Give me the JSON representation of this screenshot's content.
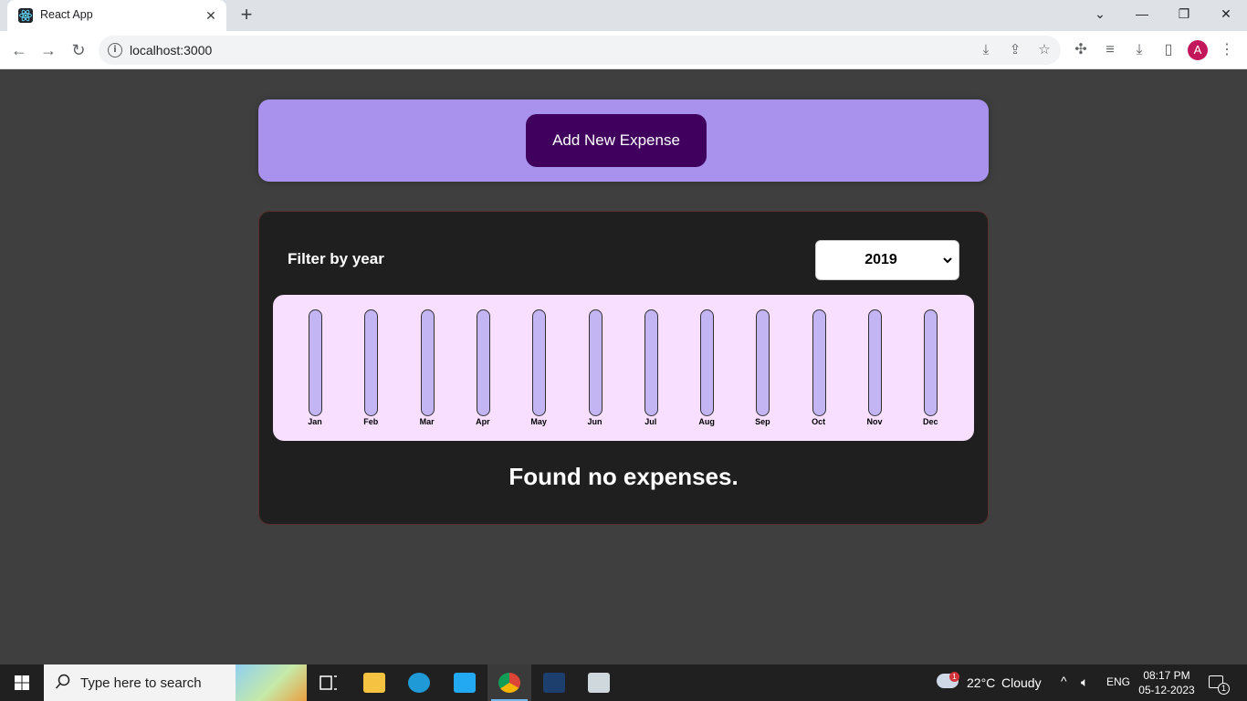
{
  "browser": {
    "tab_title": "React App",
    "tab_close": "✕",
    "new_tab": "+",
    "url": "localhost:3000",
    "profile_initial": "A",
    "window": {
      "minimize": "—",
      "maximize": "❐",
      "close": "✕",
      "tabs_menu": "⌄"
    }
  },
  "app": {
    "new_expense": {
      "button_label": "Add New Expense"
    },
    "filter": {
      "label": "Filter by year",
      "selected_year": "2019"
    },
    "chart_data": {
      "type": "bar",
      "categories": [
        "Jan",
        "Feb",
        "Mar",
        "Apr",
        "May",
        "Jun",
        "Jul",
        "Aug",
        "Sep",
        "Oct",
        "Nov",
        "Dec"
      ],
      "values": [
        0,
        0,
        0,
        0,
        0,
        0,
        0,
        0,
        0,
        0,
        0,
        0
      ]
    },
    "empty_message": "Found no expenses."
  },
  "taskbar": {
    "search_placeholder": "Type here to search",
    "weather_temp": "22°C",
    "weather_desc": "Cloudy",
    "weather_badge": "1",
    "language": "ENG",
    "time": "08:17 PM",
    "date": "05-12-2023",
    "notifications_count": "1"
  },
  "colors": {
    "page_bg": "#3f3f3f",
    "new_expense_bg": "#a892ee",
    "button_bg": "#40005d",
    "expenses_bg": "#1f1f1f",
    "chart_bg": "#f8dfff",
    "bar_track": "#c3b4f3",
    "bar_fill": "#4826b9"
  }
}
